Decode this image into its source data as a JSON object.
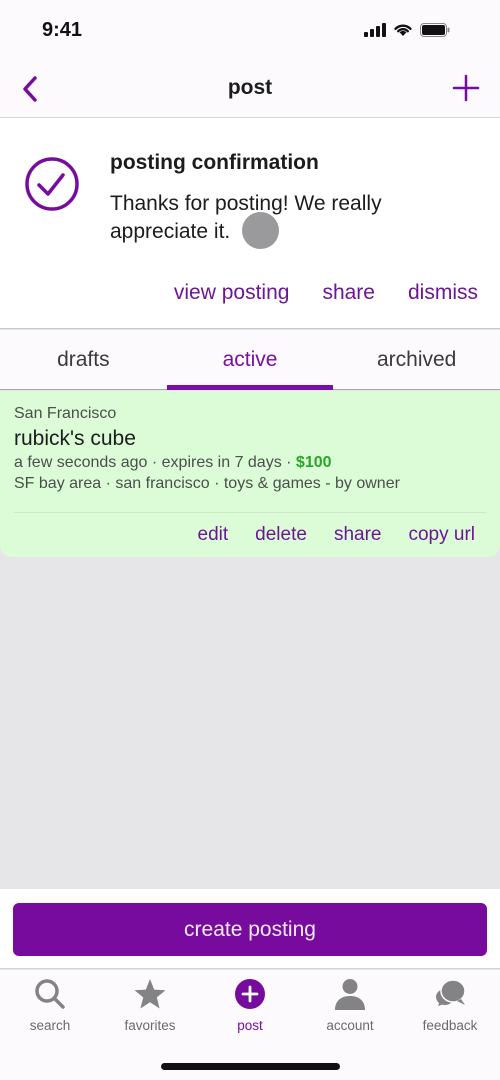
{
  "status_bar": {
    "time": "9:41"
  },
  "nav": {
    "title": "post",
    "back_icon": "chevron-left-icon",
    "add_icon": "plus-icon"
  },
  "confirmation": {
    "title": "posting confirmation",
    "message": "Thanks for posting! We really appreciate it.",
    "actions": [
      "view posting",
      "share",
      "dismiss"
    ]
  },
  "tabs": [
    {
      "label": "drafts",
      "active": false
    },
    {
      "label": "active",
      "active": true
    },
    {
      "label": "archived",
      "active": false
    }
  ],
  "posting": {
    "city": "San Francisco",
    "title": "rubick's cube",
    "meta": "a few seconds ago · expires in 7 days · ",
    "price": "$100",
    "location": "SF bay area · san francisco · toys & games - by owner",
    "actions": [
      "edit",
      "delete",
      "share",
      "copy url"
    ]
  },
  "create_button": "create posting",
  "tab_bar": [
    {
      "label": "search",
      "icon": "search-icon"
    },
    {
      "label": "favorites",
      "icon": "star-icon"
    },
    {
      "label": "post",
      "icon": "plus-circle-icon",
      "active": true
    },
    {
      "label": "account",
      "icon": "person-icon"
    },
    {
      "label": "feedback",
      "icon": "chat-bubbles-icon"
    }
  ],
  "colors": {
    "accent": "#760b9e",
    "price": "#2aa52a",
    "card_bg": "#dcfcd8"
  }
}
